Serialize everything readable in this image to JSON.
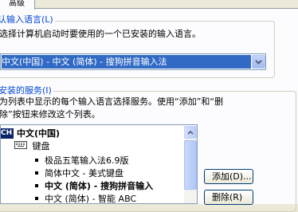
{
  "tabs": [
    {
      "label": "高级"
    }
  ],
  "default_language": {
    "legend": "默认输入语言(L)",
    "description": "选择计算机启动时要使用的一个已安装的输入语言。",
    "selected": "中文(中国) - 中文 (简体) - 搜狗拼音输入法"
  },
  "installed_services": {
    "legend": "已安装的服务(I)",
    "description_line1": "为列表中显示的每个输入语言选择服务。使用“添加”和“删",
    "description_line2": "除”按钮来修改这个列表。",
    "tree": {
      "language_badge": "CH",
      "language": "中文(中国)",
      "category": "键盘",
      "items": [
        {
          "label": "极品五笔输入法6.9版",
          "bold": false
        },
        {
          "label": "简体中文 - 美式键盘",
          "bold": false
        },
        {
          "label": "中文 (简体) - 搜狗拼音输入",
          "bold": true
        },
        {
          "label": "中文 (简体) - 智能 ABC",
          "bold": false
        }
      ]
    },
    "add_button": "添加(D)...",
    "remove_button": "删除(R)"
  }
}
